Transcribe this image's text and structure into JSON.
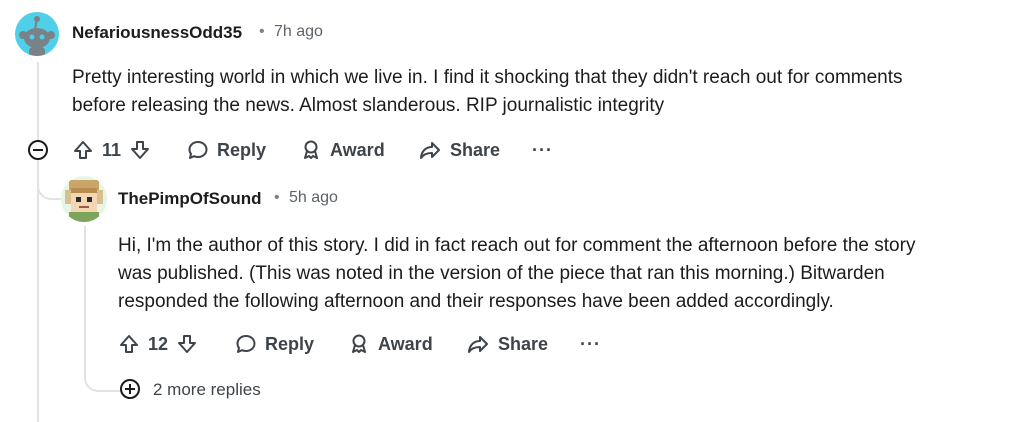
{
  "comments": [
    {
      "username": "NefariousnessOdd35",
      "separator": "•",
      "time": "7h ago",
      "body_lines": [
        "Pretty interesting world in which we live in. I find it shocking that they didn't reach out for comments",
        "before releasing the news. Almost slanderous. RIP journalistic integrity"
      ],
      "votes": "11",
      "reply_label": "Reply",
      "award_label": "Award",
      "share_label": "Share",
      "more_label": "···"
    },
    {
      "username": "ThePimpOfSound",
      "separator": "•",
      "time": "5h ago",
      "body_lines": [
        "Hi, I'm the author of this story. I did in fact reach out for comment the afternoon before the story",
        "was published. (This was noted in the version of the piece that ran this morning.) Bitwarden",
        "responded the following afternoon and their responses have been added accordingly."
      ],
      "votes": "12",
      "reply_label": "Reply",
      "award_label": "Award",
      "share_label": "Share",
      "more_label": "···"
    }
  ],
  "more_replies_label": "2 more replies",
  "colors": {
    "text": "#1c1c1c",
    "meta": "#5c6369",
    "thread": "#dfe3e6",
    "avatar_bg": "#4fd0e8"
  }
}
